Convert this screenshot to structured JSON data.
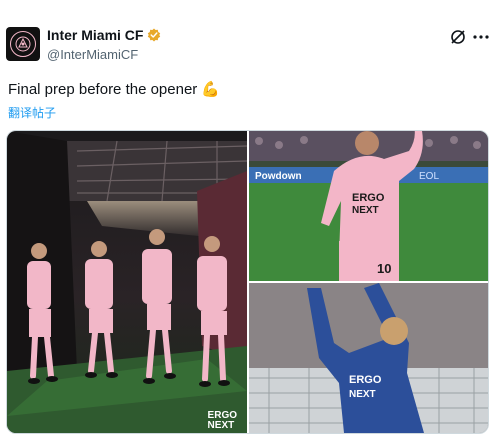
{
  "account": {
    "display_name": "Inter Miami CF",
    "handle": "@InterMiamiCF",
    "verified": true,
    "verified_badge_color": "#e8a92b",
    "avatar_icon": "inter-miami-crest"
  },
  "tweet": {
    "text": "Final prep before the opener",
    "emoji": "💪",
    "translate_label": "翻译帖子"
  },
  "header_actions": {
    "grok_icon": "grok-icon",
    "more_icon": "more-options-icon"
  },
  "media": {
    "photos": [
      {
        "description_icon": "players-walking-tunnel-photo",
        "watermark_line1": "ERGO",
        "watermark_line2": "NEXT"
      },
      {
        "description_icon": "player-pink-jersey-photo",
        "jersey_sponsor": "ERGO",
        "jersey_sponsor2": "NEXT",
        "jersey_number": "10",
        "board_text": "Powdown",
        "board_text2": "EOL"
      },
      {
        "description_icon": "goalkeeper-celebrating-photo",
        "jersey_sponsor": "ERGO",
        "jersey_sponsor2": "NEXT"
      }
    ]
  },
  "colors": {
    "link": "#1d9bf0",
    "brand_pink": "#f4b8c9",
    "text_secondary": "#536471"
  }
}
